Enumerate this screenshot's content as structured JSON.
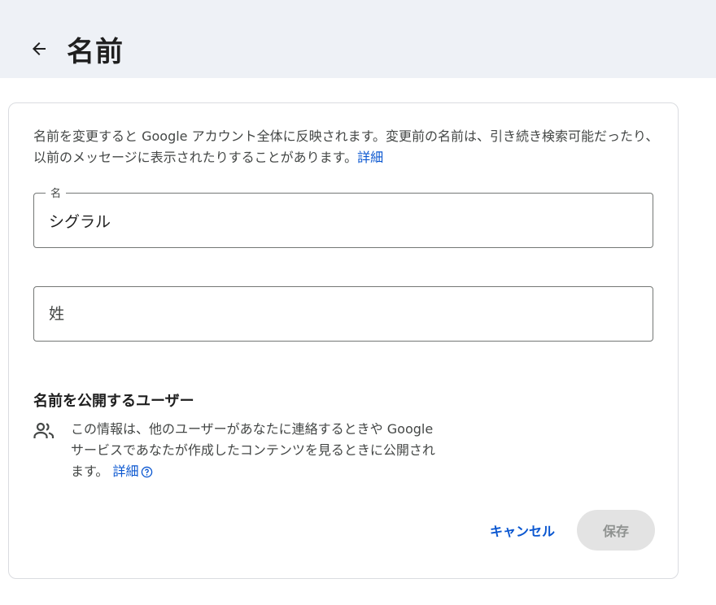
{
  "header": {
    "back_icon": "arrow-back-icon",
    "title": "名前"
  },
  "card": {
    "description": "名前を変更すると Google アカウント全体に反映されます。変更前の名前は、引き続き検索可能だったり、以前のメッセージに表示されたりすることがあります。",
    "description_link": "詳細",
    "first_name": {
      "label": "名",
      "value": "シグラル"
    },
    "last_name": {
      "placeholder": "姓",
      "value": ""
    },
    "visibility": {
      "title": "名前を公開するユーザー",
      "icon": "people-icon",
      "text": "この情報は、他のユーザーがあなたに連絡するときや Google サービスであなたが作成したコンテンツを見るときに公開されます。",
      "link": "詳細",
      "link_icon": "help-circle-icon"
    },
    "buttons": {
      "cancel": "キャンセル",
      "save": "保存"
    }
  },
  "colors": {
    "header_bg": "#eef1f6",
    "link": "#0b57d0",
    "border": "#dadce0",
    "disabled_button_bg": "#e3e3e3"
  }
}
